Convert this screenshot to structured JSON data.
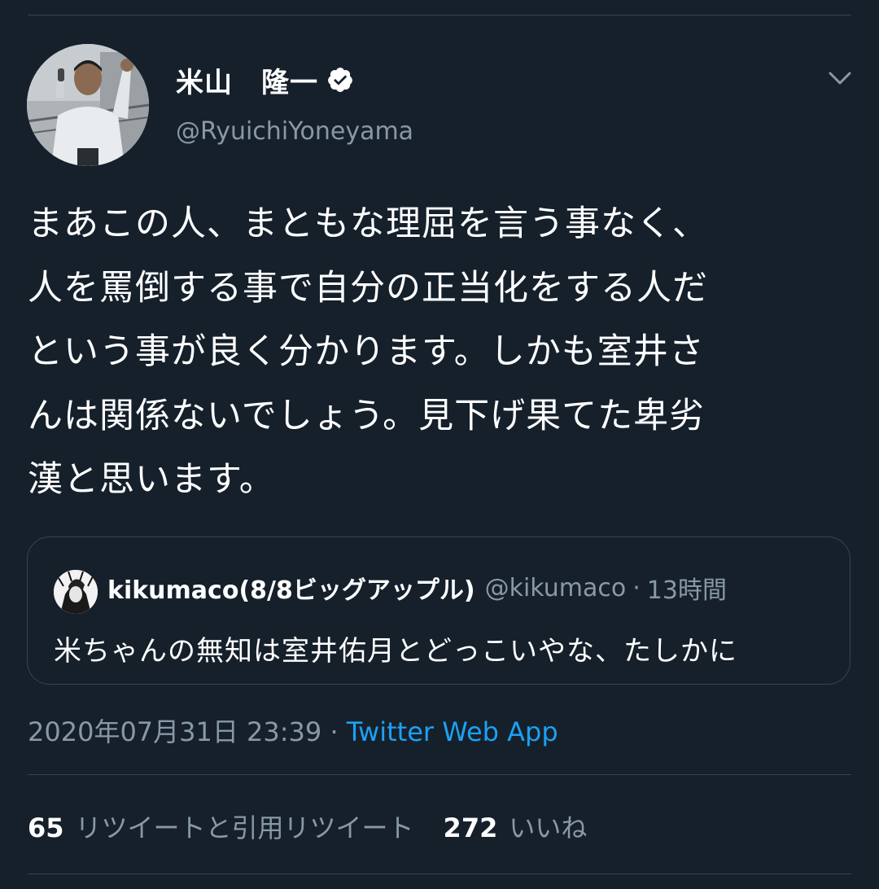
{
  "author": {
    "display_name": "米山　隆一",
    "handle": "@RyuichiYoneyama",
    "verified": true
  },
  "tweet": {
    "lines": [
      "まあこの人、まともな理屈を言う事なく、",
      "人を罵倒する事で自分の正当化をする人だ",
      "という事が良く分かります。しかも室井さ",
      "んは関係ないでしょう。見下げ果てた卑劣",
      "漢と思います。"
    ]
  },
  "quoted_tweet": {
    "name": "kikumaco(8/8ビッグアップル)",
    "handle": "@kikumaco",
    "separator": "·",
    "time": "13時間",
    "text": "米ちゃんの無知は室井佑月とどっこいやな、たしかに"
  },
  "meta": {
    "timestamp": "2020年07月31日 23:39",
    "separator": " · ",
    "source": "Twitter Web App"
  },
  "stats": {
    "retweets_count": "65",
    "retweets_label": "リツイートと引用リツイート",
    "likes_count": "272",
    "likes_label": "いいね"
  },
  "colors": {
    "background": "#15202b",
    "text": "#ffffff",
    "secondary_text": "#8899a6",
    "link": "#1da1f2",
    "border": "#38444d"
  },
  "icons": {
    "verified": "verified-badge-icon",
    "caret": "chevron-down-icon"
  }
}
